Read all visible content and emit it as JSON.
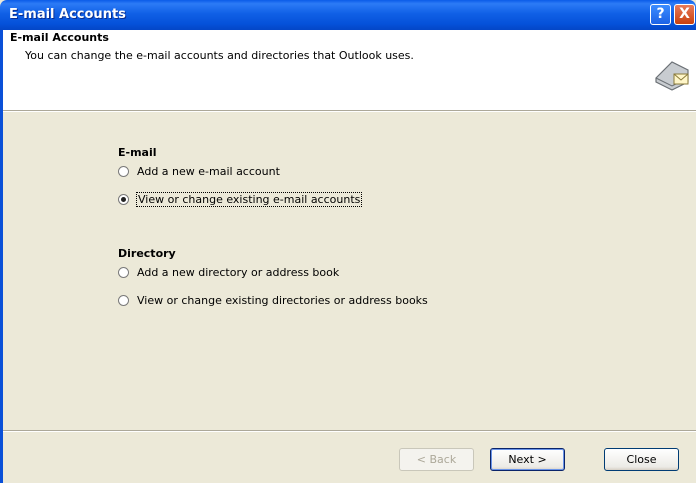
{
  "window": {
    "title": "E-mail Accounts",
    "help_glyph": "?",
    "close_glyph": "X"
  },
  "header": {
    "title": "E-mail Accounts",
    "description": "You can change the e-mail accounts and directories that Outlook uses.",
    "icon": "mail-accounts-icon"
  },
  "email_group": {
    "label": "E-mail",
    "options": [
      {
        "label": "Add a new e-mail account",
        "checked": false
      },
      {
        "label": "View or change existing e-mail accounts",
        "checked": true
      }
    ]
  },
  "directory_group": {
    "label": "Directory",
    "options": [
      {
        "label": "Add a new directory or address book",
        "checked": false
      },
      {
        "label": "View or change existing directories or address books",
        "checked": false
      }
    ]
  },
  "buttons": {
    "back": "< Back",
    "next": "Next >",
    "close": "Close"
  },
  "colors": {
    "titlebar": "#0551D9",
    "dialog_bg": "#ECE9D8",
    "close_button": "#C9400E"
  }
}
